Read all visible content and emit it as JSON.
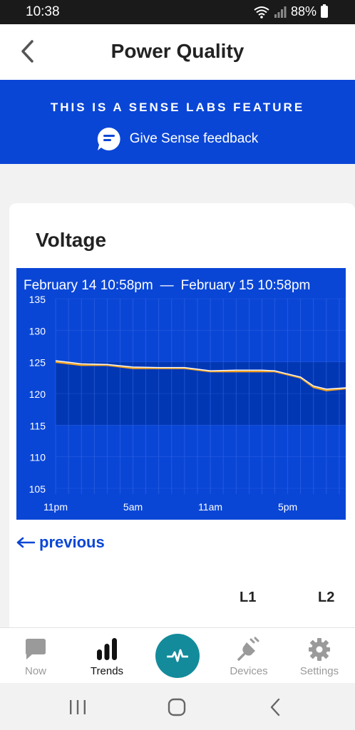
{
  "status_bar": {
    "time": "10:38",
    "battery": "88%"
  },
  "header": {
    "title": "Power Quality"
  },
  "banner": {
    "title": "THIS IS A SENSE LABS FEATURE",
    "feedback_label": "Give Sense feedback"
  },
  "card": {
    "title": "Voltage",
    "range": {
      "start": "February 14  10:58pm",
      "separator": "—",
      "end": "February 15  10:58pm"
    },
    "previous_label": "previous",
    "columns": [
      "L1",
      "L2"
    ]
  },
  "chart_data": {
    "type": "line",
    "ylim": [
      105,
      135
    ],
    "yticks": [
      105,
      110,
      115,
      120,
      125,
      130,
      135
    ],
    "xticks": [
      "11pm",
      "5am",
      "11am",
      "5pm"
    ],
    "xtick_hours": [
      0,
      6,
      12,
      18
    ],
    "xlim_hours": [
      0,
      22.5
    ],
    "normal_band": [
      115,
      125
    ],
    "series": [
      {
        "color": "#f0a020",
        "x_hours": [
          0,
          2,
          4,
          6,
          8,
          10,
          12,
          14,
          16,
          17,
          18,
          19,
          20,
          21,
          22.5
        ],
        "values": [
          125,
          124.5,
          124.5,
          124,
          124,
          124,
          123.5,
          123.5,
          123.5,
          123.5,
          123,
          122.5,
          121,
          120.5,
          120.8
        ]
      },
      {
        "color": "#ffffff",
        "x_hours": [
          0,
          2,
          4,
          6,
          8,
          10,
          12,
          14,
          16,
          17,
          18,
          19,
          20,
          21,
          22.5
        ],
        "values": [
          125.2,
          124.7,
          124.6,
          124.2,
          124.1,
          124.1,
          123.6,
          123.7,
          123.7,
          123.6,
          123.1,
          122.6,
          121.2,
          120.7,
          120.9
        ]
      }
    ]
  },
  "bottom_nav": {
    "items": [
      {
        "label": "Now"
      },
      {
        "label": "Trends"
      },
      {
        "label": "Devices"
      },
      {
        "label": "Settings"
      }
    ]
  },
  "colors": {
    "brand_blue": "#0a46d6",
    "accent_teal": "#138b9b",
    "series_orange": "#f0a020"
  }
}
